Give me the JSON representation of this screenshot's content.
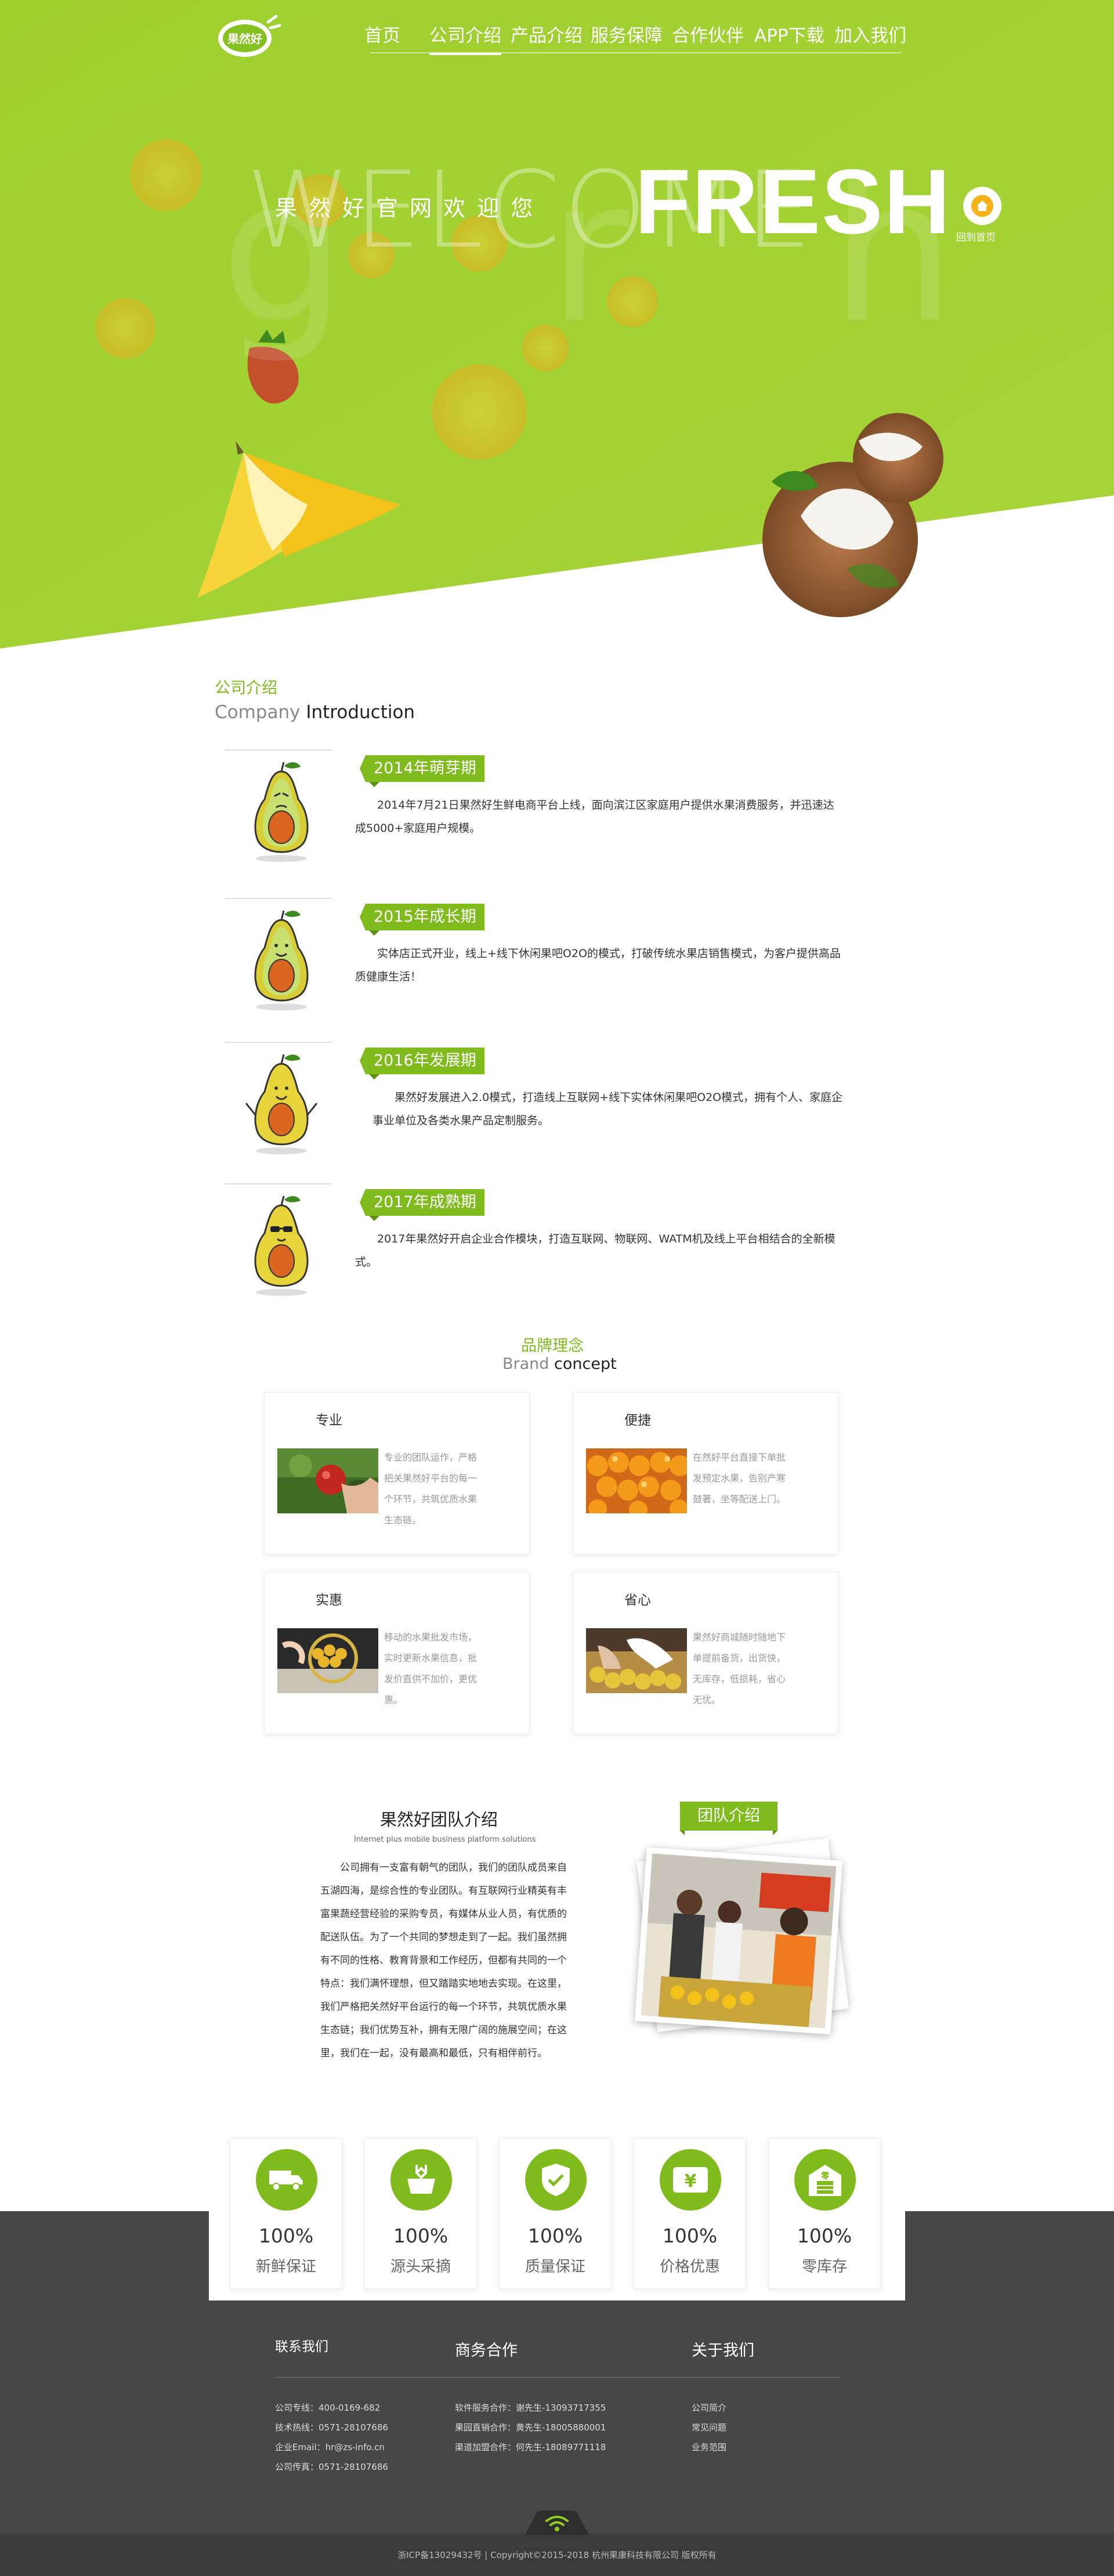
{
  "logo": {
    "text": "果然好"
  },
  "nav": {
    "items": [
      {
        "label": "首页"
      },
      {
        "label": "公司介绍"
      },
      {
        "label": "产品介绍"
      },
      {
        "label": "服务保障"
      },
      {
        "label": "合作伙伴"
      },
      {
        "label": "APP下载"
      },
      {
        "label": "加入我们"
      }
    ],
    "active_index": 1
  },
  "hero": {
    "welcome": "WELCOME",
    "ghost_letters": "g r h",
    "title_cn": "果然好官网欢迎您",
    "fresh": "FRESH",
    "home_label": "回到首页"
  },
  "company": {
    "title_cn": "公司介绍",
    "title_en_light": "Company ",
    "title_en_dark": "Introduction",
    "timeline": [
      {
        "tag": "2014年萌芽期",
        "text": "2014年7月21日果然好生鲜电商平台上线，面向滨江区家庭用户提供水果消费服务，并迅速达成5000+家庭用户规模。"
      },
      {
        "tag": "2015年成长期",
        "text": "实体店正式开业，线上+线下休闲果吧O2O的模式，打破传统水果店销售模式，为客户提供高品质健康生活！"
      },
      {
        "tag": "2016年发展期",
        "text": "果然好发展进入2.0模式，打造线上互联网+线下实体休闲果吧O2O模式，拥有个人、家庭企事业单位及各类水果产品定制服务。"
      },
      {
        "tag": "2017年成熟期",
        "text": "2017年果然好开启企业合作模块，打造互联网、物联网、WATM机及线上平台相结合的全新模式。"
      }
    ]
  },
  "brand": {
    "title_cn": "品牌理念",
    "title_en_light": "Brand ",
    "title_en_dark": "concept",
    "cards": [
      {
        "title": "专业",
        "text": "专业的团队运作，严格把关果然好平台的每一个环节，共筑优质水果生态链。"
      },
      {
        "title": "便捷",
        "text": "在然好平台直接下单批发预定水果，告别产寒鼓著，坐等配送上门。"
      },
      {
        "title": "实惠",
        "text": "移动的水果批发市场，实时更新水果信息，批发价直供不加价，更优惠。"
      },
      {
        "title": "省心",
        "text": "果然好商城随时随地下单提前备货，出货快，无库存，低损耗，省心无忧。"
      }
    ]
  },
  "team": {
    "title": "果然好团队介绍",
    "subtitle": "Internet plus mobile business platform solutions",
    "text": "公司拥有一支富有朝气的团队，我们的团队成员来自五湖四海，是综合性的专业团队。有互联网行业精英有丰富果蔬经营经验的采购专员，有媒体从业人员，有优质的配送队伍。为了一个共同的梦想走到了一起。我们虽然拥有不同的性格、教育背景和工作经历，但都有共同的一个特点：我们满怀理想，但又踏踏实地地去实现。在这里，我们严格把关然好平台运行的每一个环节，共筑优质水果生态链；我们优势互补，拥有无限广阔的施展空间；在这里，我们在一起，没有最高和最低，只有相伴前行。",
    "tag": "团队介绍"
  },
  "features": [
    {
      "icon": "truck-icon",
      "value": "100%",
      "label": "新鲜保证"
    },
    {
      "icon": "basket-icon",
      "value": "100%",
      "label": "源头采摘"
    },
    {
      "icon": "shield-check-icon",
      "value": "100%",
      "label": "质量保证"
    },
    {
      "icon": "yen-icon",
      "value": "100%",
      "label": "价格优惠"
    },
    {
      "icon": "warehouse-icon",
      "value": "100%",
      "label": "零库存"
    }
  ],
  "footer": {
    "contact": {
      "title": "联系我们",
      "items": [
        "公司专线：400-0169-682",
        "技术热线：0571-28107686",
        "企业Email：hr@zs-info.cn",
        "公司传真：0571-28107686"
      ]
    },
    "business": {
      "title": "商务合作",
      "items": [
        "软件服务合作：谢先生-13093717355",
        "果园直销合作：黄先生-18005880001",
        "渠道加盟合作：何先生-18089771118"
      ]
    },
    "about": {
      "title": "关于我们",
      "items": [
        "公司简介",
        "常见问题",
        "业务范围"
      ]
    },
    "copyright": "浙ICP备13029432号 | Copyright©2015-2018 杭州果康科技有限公司 版权所有"
  },
  "colors": {
    "accent": "#7fbb1c",
    "accent_light": "#a5d23d",
    "footer": "#474747"
  }
}
